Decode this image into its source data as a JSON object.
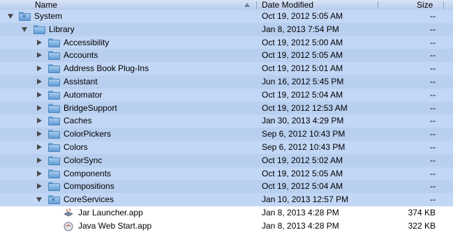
{
  "columns": {
    "name": "Name",
    "date": "Date Modified",
    "size": "Size"
  },
  "rows": [
    {
      "name": "System",
      "date": "Oct 19, 2012 5:05 AM",
      "size": "--"
    },
    {
      "name": "Library",
      "date": "Jan 8, 2013 7:54 PM",
      "size": "--"
    },
    {
      "name": "Accessibility",
      "date": "Oct 19, 2012 5:00 AM",
      "size": "--"
    },
    {
      "name": "Accounts",
      "date": "Oct 19, 2012 5:05 AM",
      "size": "--"
    },
    {
      "name": "Address Book Plug-Ins",
      "date": "Oct 19, 2012 5:01 AM",
      "size": "--"
    },
    {
      "name": "Assistant",
      "date": "Jun 16, 2012 5:45 PM",
      "size": "--"
    },
    {
      "name": "Automator",
      "date": "Oct 19, 2012 5:04 AM",
      "size": "--"
    },
    {
      "name": "BridgeSupport",
      "date": "Oct 19, 2012 12:53 AM",
      "size": "--"
    },
    {
      "name": "Caches",
      "date": "Jan 30, 2013 4:29 PM",
      "size": "--"
    },
    {
      "name": "ColorPickers",
      "date": "Sep 6, 2012 10:43 PM",
      "size": "--"
    },
    {
      "name": "Colors",
      "date": "Sep 6, 2012 10:43 PM",
      "size": "--"
    },
    {
      "name": "ColorSync",
      "date": "Oct 19, 2012 5:02 AM",
      "size": "--"
    },
    {
      "name": "Components",
      "date": "Oct 19, 2012 5:05 AM",
      "size": "--"
    },
    {
      "name": "Compositions",
      "date": "Oct 19, 2012 5:04 AM",
      "size": "--"
    },
    {
      "name": "CoreServices",
      "date": "Jan 10, 2013 12:57 PM",
      "size": "--"
    },
    {
      "name": "Jar Launcher.app",
      "date": "Jan 8, 2013 4:28 PM",
      "size": "374 KB"
    },
    {
      "name": "Java Web Start.app",
      "date": "Jan 8, 2013 4:28 PM",
      "size": "322 KB"
    }
  ],
  "icons": {
    "folder": "folder-icon",
    "system_folder": "system-folder-icon",
    "app": "app-icon",
    "sort": "sort-ascending-icon"
  },
  "colors": {
    "selection": "#c2d6f5",
    "header": "#c9d8f0",
    "folder": "#6aa5d8"
  }
}
